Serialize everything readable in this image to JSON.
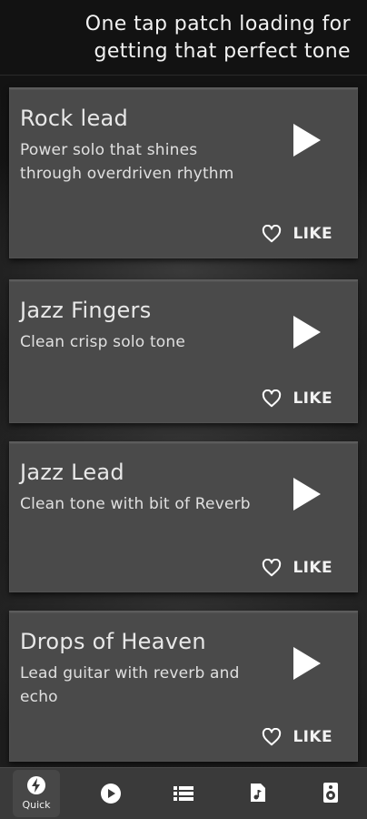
{
  "header": {
    "title": "One tap patch loading for getting that perfect tone"
  },
  "cards": [
    {
      "title": "Rock lead",
      "description": "Power solo that shines through overdriven rhythm",
      "like_label": "LIKE"
    },
    {
      "title": "Jazz Fingers",
      "description": "Clean crisp solo tone",
      "like_label": "LIKE"
    },
    {
      "title": "Jazz Lead",
      "description": "Clean tone with bit of Reverb",
      "like_label": "LIKE"
    },
    {
      "title": "Drops of Heaven",
      "description": "Lead guitar with reverb and echo",
      "like_label": "LIKE"
    }
  ],
  "tabbar": {
    "tabs": [
      {
        "icon": "lightning-icon",
        "label": "Quick",
        "active": true
      },
      {
        "icon": "play-circle-icon",
        "label": ""
      },
      {
        "icon": "list-icon",
        "label": ""
      },
      {
        "icon": "music-file-icon",
        "label": ""
      },
      {
        "icon": "speaker-icon",
        "label": ""
      }
    ]
  },
  "colors": {
    "card": "#4a4a4a",
    "header": "#121212",
    "tabbar": "#3a3a3a",
    "text": "#ffffff"
  }
}
